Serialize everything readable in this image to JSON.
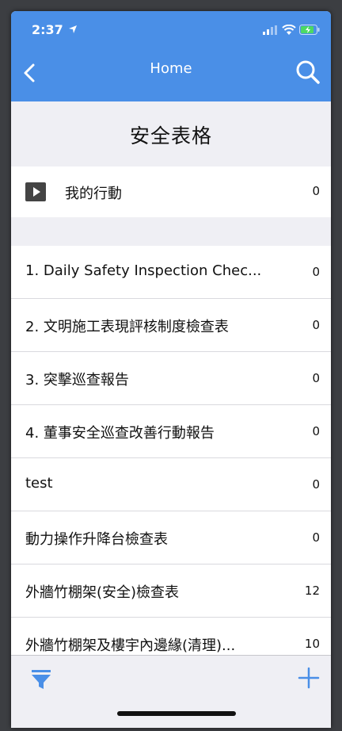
{
  "status": {
    "time": "2:37"
  },
  "navbar": {
    "title": "Home"
  },
  "page": {
    "title": "安全表格"
  },
  "my_actions": {
    "label": "我的行動",
    "count": "0"
  },
  "forms": [
    {
      "label": "1. Daily Safety Inspection Chec...",
      "count": "0"
    },
    {
      "label": "2. 文明施工表現評核制度檢查表",
      "count": "0"
    },
    {
      "label": "3. 突擊巡查報告",
      "count": "0"
    },
    {
      "label": "4. 董事安全巡查改善行動報告",
      "count": "0"
    },
    {
      "label": "test",
      "count": "0"
    },
    {
      "label": "動力操作升降台檢查表",
      "count": "0"
    },
    {
      "label": "外牆竹棚架(安全)檢查表",
      "count": "12"
    },
    {
      "label": "外牆竹棚架及樓宇內邊緣(清理)...",
      "count": "10"
    }
  ],
  "icons": {
    "back": "chevron-left-icon",
    "search": "search-icon",
    "filter": "filter-icon",
    "add": "plus-icon",
    "play": "play-icon"
  },
  "colors": {
    "accent": "#4a8fe7",
    "background": "#efeff4"
  }
}
